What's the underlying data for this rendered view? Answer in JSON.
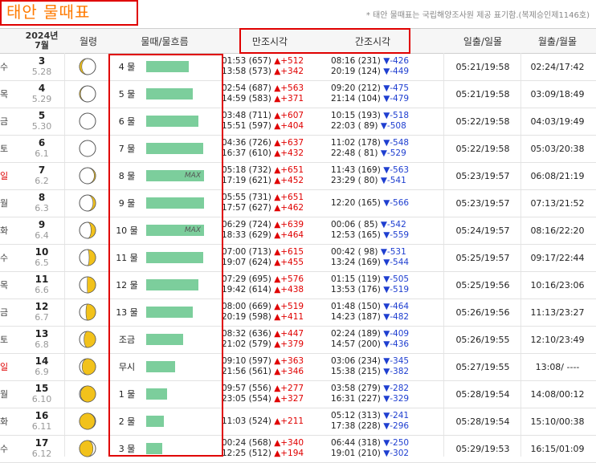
{
  "title": "태안 물때표",
  "copyright": "* 태안 물때표는 국립해양조사원 제공 표기함.(복제승인제1146호)",
  "header": {
    "year": "2024년",
    "month": "7월",
    "moon_phase": "월령",
    "tide": "물때/물흐름",
    "high": "만조시각",
    "low": "간조시각",
    "sun": "일출/일몰",
    "moonrise": "월출/월몰"
  },
  "rows": [
    {
      "dow": "수",
      "red": false,
      "day": "3",
      "lunar": "5.28",
      "phase": 0.93,
      "tide": "4 물",
      "bar": 0.74,
      "max": "",
      "hi1": "01:53 (657)",
      "hd1": "▲+512",
      "hi2": "13:58 (573)",
      "hd2": "▲+342",
      "lo1": "08:16 (231)",
      "ld1": "▼-426",
      "lo2": "20:19 (124)",
      "ld2": "▼-449",
      "sun": "05:21/19:58",
      "moon": "02:24/17:42"
    },
    {
      "dow": "목",
      "red": false,
      "day": "4",
      "lunar": "5.29",
      "phase": 0.97,
      "tide": "5 물",
      "bar": 0.8,
      "max": "",
      "hi1": "02:54 (687)",
      "hd1": "▲+563",
      "hi2": "14:59 (583)",
      "hd2": "▲+371",
      "lo1": "09:20 (212)",
      "ld1": "▼-475",
      "lo2": "21:14 (104)",
      "ld2": "▼-479",
      "sun": "05:21/19:58",
      "moon": "03:09/18:49"
    },
    {
      "dow": "금",
      "red": false,
      "day": "5",
      "lunar": "5.30",
      "phase": 1.0,
      "tide": "6 물",
      "bar": 0.9,
      "max": "",
      "hi1": "03:48 (711)",
      "hd1": "▲+607",
      "hi2": "15:51 (597)",
      "hd2": "▲+404",
      "lo1": "10:15 (193)",
      "ld1": "▼-518",
      "lo2": "22:03 ( 89)",
      "ld2": "▼-508",
      "sun": "05:22/19:58",
      "moon": "04:03/19:49"
    },
    {
      "dow": "토",
      "red": false,
      "day": "6",
      "lunar": "6.1",
      "phase": 0.0,
      "tide": "7 물",
      "bar": 0.98,
      "max": "",
      "hi1": "04:36 (726)",
      "hd1": "▲+637",
      "hi2": "16:37 (610)",
      "hd2": "▲+432",
      "lo1": "11:02 (178)",
      "ld1": "▼-548",
      "lo2": "22:48 ( 81)",
      "ld2": "▼-529",
      "sun": "05:22/19:58",
      "moon": "05:03/20:38"
    },
    {
      "dow": "일",
      "red": true,
      "day": "7",
      "lunar": "6.2",
      "phase": 0.04,
      "tide": "8 물",
      "bar": 1.0,
      "max": "MAX",
      "hi1": "05:18 (732)",
      "hd1": "▲+651",
      "hi2": "17:19 (621)",
      "hd2": "▲+452",
      "lo1": "11:43 (169)",
      "ld1": "▼-563",
      "lo2": "23:29 ( 80)",
      "ld2": "▼-541",
      "sun": "05:23/19:57",
      "moon": "06:08/21:19"
    },
    {
      "dow": "월",
      "red": false,
      "day": "8",
      "lunar": "6.3",
      "phase": 0.08,
      "tide": "9 물",
      "bar": 1.0,
      "max": "",
      "hi1": "05:55 (731)",
      "hd1": "▲+651",
      "hi2": "17:57 (627)",
      "hd2": "▲+462",
      "lo1": "12:20 (165)",
      "ld1": "▼-566",
      "lo2": "",
      "ld2": "",
      "sun": "05:23/19:57",
      "moon": "07:13/21:52"
    },
    {
      "dow": "화",
      "red": false,
      "day": "9",
      "lunar": "6.4",
      "phase": 0.14,
      "tide": "10 물",
      "bar": 1.0,
      "max": "MAX",
      "hi1": "06:29 (724)",
      "hd1": "▲+639",
      "hi2": "18:33 (629)",
      "hd2": "▲+464",
      "lo1": "00:06 ( 85)",
      "ld1": "▼-542",
      "lo2": "12:53 (165)",
      "ld2": "▼-559",
      "sun": "05:24/19:57",
      "moon": "08:16/22:20"
    },
    {
      "dow": "수",
      "red": false,
      "day": "10",
      "lunar": "6.5",
      "phase": 0.2,
      "tide": "11 물",
      "bar": 0.98,
      "max": "",
      "hi1": "07:00 (713)",
      "hd1": "▲+615",
      "hi2": "19:07 (624)",
      "hd2": "▲+455",
      "lo1": "00:42 ( 98)",
      "ld1": "▼-531",
      "lo2": "13:24 (169)",
      "ld2": "▼-544",
      "sun": "05:25/19:57",
      "moon": "09:17/22:44"
    },
    {
      "dow": "목",
      "red": false,
      "day": "11",
      "lunar": "6.6",
      "phase": 0.26,
      "tide": "12 물",
      "bar": 0.9,
      "max": "",
      "hi1": "07:29 (695)",
      "hd1": "▲+576",
      "hi2": "19:42 (614)",
      "hd2": "▲+438",
      "lo1": "01:15 (119)",
      "ld1": "▼-505",
      "lo2": "13:53 (176)",
      "ld2": "▼-519",
      "sun": "05:25/19:56",
      "moon": "10:16/23:06"
    },
    {
      "dow": "금",
      "red": false,
      "day": "12",
      "lunar": "6.7",
      "phase": 0.3,
      "tide": "13 물",
      "bar": 0.8,
      "max": "",
      "hi1": "08:00 (669)",
      "hd1": "▲+519",
      "hi2": "20:19 (598)",
      "hd2": "▲+411",
      "lo1": "01:48 (150)",
      "ld1": "▼-464",
      "lo2": "14:23 (187)",
      "ld2": "▼-482",
      "sun": "05:26/19:56",
      "moon": "11:13/23:27"
    },
    {
      "dow": "토",
      "red": false,
      "day": "13",
      "lunar": "6.8",
      "phase": 0.36,
      "tide": "조금",
      "bar": 0.64,
      "max": "",
      "hi1": "08:32 (636)",
      "hd1": "▲+447",
      "hi2": "21:02 (579)",
      "hd2": "▲+379",
      "lo1": "02:24 (189)",
      "ld1": "▼-409",
      "lo2": "14:57 (200)",
      "ld2": "▼-436",
      "sun": "05:26/19:55",
      "moon": "12:10/23:49"
    },
    {
      "dow": "일",
      "red": true,
      "day": "14",
      "lunar": "6.9",
      "phase": 0.42,
      "tide": "무시",
      "bar": 0.5,
      "max": "",
      "hi1": "09:10 (597)",
      "hd1": "▲+363",
      "hi2": "21:56 (561)",
      "hd2": "▲+346",
      "lo1": "03:06 (234)",
      "ld1": "▼-345",
      "lo2": "15:38 (215)",
      "ld2": "▼-382",
      "sun": "05:27/19:55",
      "moon": "13:08/ ----"
    },
    {
      "dow": "월",
      "red": false,
      "day": "15",
      "lunar": "6.10",
      "phase": 0.47,
      "tide": "1 물",
      "bar": 0.36,
      "max": "",
      "hi1": "09:57 (556)",
      "hd1": "▲+277",
      "hi2": "23:05 (554)",
      "hd2": "▲+327",
      "lo1": "03:58 (279)",
      "ld1": "▼-282",
      "lo2": "16:31 (227)",
      "ld2": "▼-329",
      "sun": "05:28/19:54",
      "moon": "14:08/00:12"
    },
    {
      "dow": "화",
      "red": false,
      "day": "16",
      "lunar": "6.11",
      "phase": 0.52,
      "tide": "2 물",
      "bar": 0.3,
      "max": "",
      "hi1": "11:03 (524)",
      "hd1": "▲+211",
      "hi2": "",
      "hd2": "",
      "lo1": "05:12 (313)",
      "ld1": "▼-241",
      "lo2": "17:38 (228)",
      "ld2": "▼-296",
      "sun": "05:28/19:54",
      "moon": "15:10/00:38"
    },
    {
      "dow": "수",
      "red": false,
      "day": "17",
      "lunar": "6.12",
      "phase": 0.58,
      "tide": "3 물",
      "bar": 0.28,
      "max": "",
      "hi1": "00:24 (568)",
      "hd1": "▲+340",
      "hi2": "12:25 (512)",
      "hd2": "▲+194",
      "lo1": "06:44 (318)",
      "ld1": "▼-250",
      "lo2": "19:01 (210)",
      "ld2": "▼-302",
      "sun": "05:29/19:53",
      "moon": "16:15/01:09"
    }
  ]
}
